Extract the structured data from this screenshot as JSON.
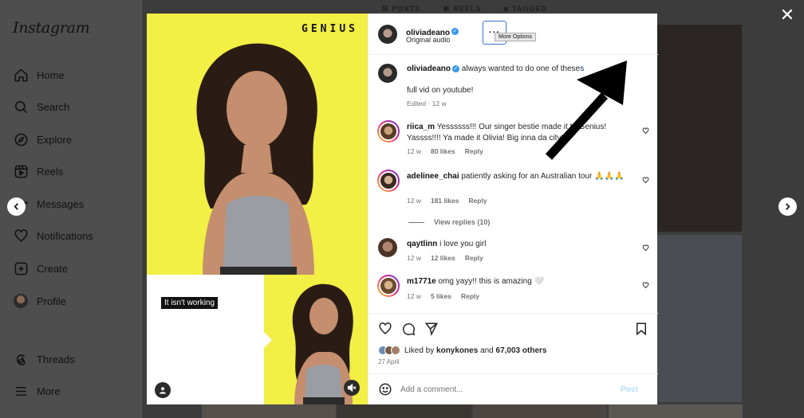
{
  "app": {
    "logo": "Instagram"
  },
  "sidebar": {
    "items": [
      {
        "label": "Home",
        "icon": "home-icon"
      },
      {
        "label": "Search",
        "icon": "search-icon"
      },
      {
        "label": "Explore",
        "icon": "compass-icon"
      },
      {
        "label": "Reels",
        "icon": "reels-icon"
      },
      {
        "label": "Messages",
        "icon": "messages-icon"
      },
      {
        "label": "Notifications",
        "icon": "heart-icon"
      },
      {
        "label": "Create",
        "icon": "plus-square-icon"
      },
      {
        "label": "Profile",
        "icon": "avatar"
      },
      {
        "label": "Threads",
        "icon": "threads-icon"
      },
      {
        "label": "More",
        "icon": "menu-icon"
      }
    ]
  },
  "profile_tabs": [
    "POSTS",
    "REELS",
    "TAGGED"
  ],
  "media": {
    "brand_text": "GENIUS",
    "caption_box": "It isn't working"
  },
  "post": {
    "author": "oliviadeano",
    "audio": "Original audio",
    "more_tooltip": "More Options",
    "caption_text": "always wanted to do one of these",
    "caption_link": "s",
    "caption_line2": "full vid on youtube!",
    "caption_meta": "Edited · 12 w",
    "comments": [
      {
        "user": "riica_m",
        "text": "Yessssss!!! Our singer bestie made it to Genius! Yassss!!!! Ya made it Olivia! Big inna da city!!",
        "time": "12 w",
        "likes": "80 likes",
        "reply": "Reply"
      },
      {
        "user": "adelinee_chai",
        "text": "patiently asking for an Australian tour 🙏🙏🙏",
        "time": "12 w",
        "likes": "181 likes",
        "reply": "Reply"
      },
      {
        "user": "qaytlinn",
        "text": "i love you girl",
        "time": "12 w",
        "likes": "12 likes",
        "reply": "Reply"
      },
      {
        "user": "m1771e",
        "text": "omg yayy!! this is amazing 🤍",
        "time": "12 w",
        "likes": "5 likes",
        "reply": "Reply"
      }
    ],
    "view_replies": "View replies (10)",
    "liked_by_prefix": "Liked by",
    "liked_by_user": "konykones",
    "liked_by_and": "and",
    "liked_by_others": "67,003 others",
    "date": "27 April",
    "comment_placeholder": "Add a comment...",
    "post_label": "Post"
  },
  "colors": {
    "accent": "#3897f0",
    "media_yellow": "#f2ef45",
    "highlight_border": "#3b6fd6"
  }
}
